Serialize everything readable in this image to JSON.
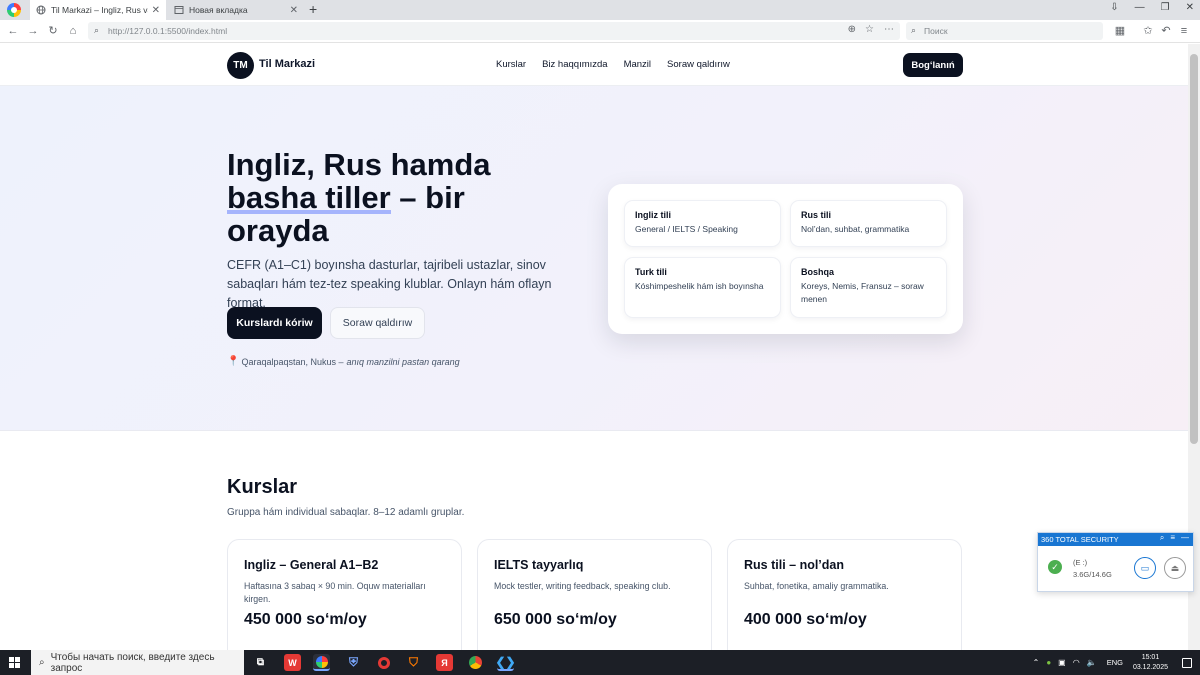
{
  "browser": {
    "tabs": [
      {
        "title": "Til Markazi – Ingliz, Rus va ba",
        "active": true
      },
      {
        "title": "Новая вкладка",
        "active": false
      }
    ],
    "url": "http://127.0.0.1:5500/index.html",
    "search_placeholder": "Поиск"
  },
  "site": {
    "logo_badge": "TM",
    "logo_text": "Til Markazi",
    "nav": [
      "Kurslar",
      "Biz haqqımızda",
      "Manzil",
      "Soraw qaldırıw"
    ],
    "contact_button": "Bog‘lanıń"
  },
  "hero": {
    "title_line1": "Ingliz, Rus hamda",
    "title_highlight": "basha tiller",
    "title_rest": " – bir orayda",
    "description": "CEFR (A1–C1) boyınsha dasturlar, tajribeli ustazlar, sinov sabaqları hám tez-tez speaking klublar. Onlayn hám oflayn format.",
    "primary_button": "Kurslardı kóriw",
    "secondary_button": "Soraw qaldırıw",
    "location_text": "Qaraqalpaqstan, Nukus –",
    "location_note": "anıq manzilni pastan qarang"
  },
  "languages": [
    {
      "name": "Ingliz tili",
      "desc": "General / IELTS / Speaking"
    },
    {
      "name": "Rus tili",
      "desc": "Nol’dan, suhbat, grammatika"
    },
    {
      "name": "Turk tili",
      "desc": "Kóshimpeshelik hám ish boyınsha"
    },
    {
      "name": "Boshqa",
      "desc": "Koreys, Nemis, Fransuz – soraw menen"
    }
  ],
  "courses": {
    "title": "Kurslar",
    "subtitle": "Gruppa hám individual sabaqlar. 8–12 adamlı gruplar.",
    "items": [
      {
        "title": "Ingliz – General A1–B2",
        "desc": "Haftasına 3 sabaq × 90 min. Oquw materialları kirgen.",
        "price": "450 000 so‘m/oy"
      },
      {
        "title": "IELTS tayyarlıq",
        "desc": "Mock testler, writing feedback, speaking club.",
        "price": "650 000 so‘m/oy"
      },
      {
        "title": "Rus tili – nol’dan",
        "desc": "Suhbat, fonetika, amaliy grammatika.",
        "price": "400 000 so‘m/oy"
      }
    ]
  },
  "security_popup": {
    "title": "360 TOTAL SECURITY",
    "drive_label": "(E :)",
    "drive_size": "3.6G/14.6G"
  },
  "taskbar": {
    "search_placeholder": "Чтобы начать поиск, введите здесь запрос",
    "language": "ENG",
    "time": "15:01",
    "date": "03.12.2025"
  },
  "colors": {
    "primary": "#0b1120",
    "highlight_underline": "#a5b4fc",
    "security_accent": "#1976d2"
  }
}
